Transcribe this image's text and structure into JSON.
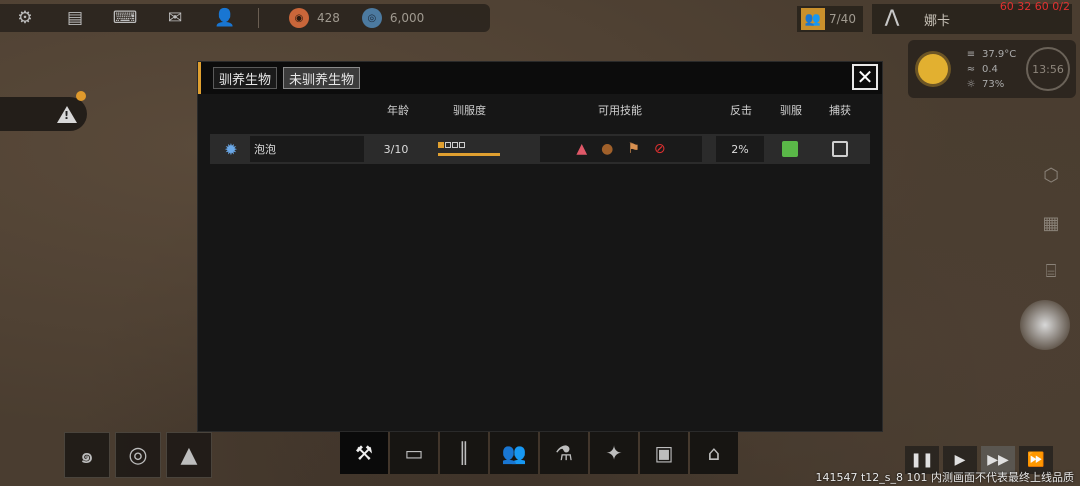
{
  "topbar": {
    "icons": [
      "gear-icon",
      "chat-icon",
      "keyboard-icon",
      "mail-icon",
      "user-icon"
    ],
    "food": "428",
    "coins": "6,000"
  },
  "population": "7/40",
  "colony_name": "娜卡",
  "fps": "60 32 60 0/2",
  "weather": {
    "temperature": "37.9°C",
    "wind": "0.4",
    "humidity": "73%",
    "time": "13:56"
  },
  "alert": {
    "glyph": "!"
  },
  "modal": {
    "tabs": [
      "驯养生物",
      "未驯养生物"
    ],
    "active_tab": 1,
    "close_label": "✕",
    "columns": {
      "age": "年龄",
      "tameness": "驯服度",
      "skills": "可用技能",
      "counterattack": "反击",
      "tame": "驯服",
      "capture": "捕获"
    },
    "rows": [
      {
        "name": "泡泡",
        "age": "3/10",
        "tameness_level": 1,
        "tameness_max": 4,
        "skills": [
          "pink-creature-icon",
          "round-shell-icon",
          "flag-icon",
          "forbidden-icon"
        ],
        "counterattack": "2%",
        "tame": true,
        "capture": false
      }
    ]
  },
  "bottom_left_buttons": [
    "galaxy-icon",
    "orbit-icon",
    "terrain-icon"
  ],
  "bottom_bar": [
    "tools-icon",
    "folder-icon",
    "audio-icon",
    "people-icon",
    "flask-icon",
    "creature-icon",
    "speech-icon",
    "bank-icon"
  ],
  "speed_controls": [
    "❚❚",
    "▶",
    "▶▶",
    "⏩"
  ],
  "build_info": "141547 t12_s_8 101  内测画面不代表最终上线品质",
  "colors": {
    "accent": "#e0a030",
    "tame_check": "#5ab848",
    "fps_red": "#e03030"
  }
}
